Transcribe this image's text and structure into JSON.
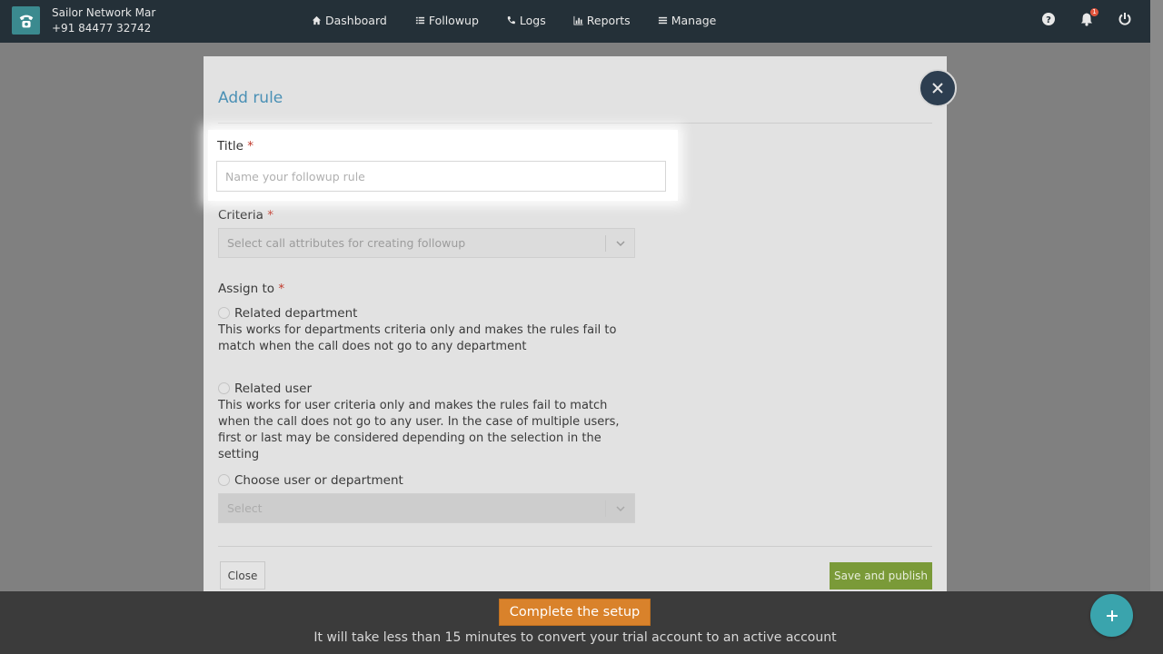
{
  "header": {
    "account_name": "Sailor Network Mar",
    "account_phone": "+91 84477 32742",
    "nav": [
      {
        "label": "Dashboard",
        "icon": "home-icon"
      },
      {
        "label": "Followup",
        "icon": "list-icon"
      },
      {
        "label": "Logs",
        "icon": "phone-icon"
      },
      {
        "label": "Reports",
        "icon": "bar-chart-icon"
      },
      {
        "label": "Manage",
        "icon": "menu-icon"
      }
    ],
    "notification_count": "1"
  },
  "modal": {
    "title": "Add rule",
    "title_field": {
      "label": "Title",
      "required": "*",
      "placeholder": "Name your followup rule",
      "value": ""
    },
    "criteria": {
      "label": "Criteria",
      "required": "*",
      "placeholder": "Select call attributes for creating followup"
    },
    "assign_to": {
      "label": "Assign to",
      "required": "*",
      "options": [
        {
          "label": "Related department",
          "description": "This works for departments criteria only and makes the rules fail to match when the call does not go to any department"
        },
        {
          "label": "Related user",
          "description": "This works for user criteria only and makes the rules fail to match when the call does not go to any user. In the case of multiple users, first or last may be considered depending on the selection in the setting"
        },
        {
          "label": "Choose user or department",
          "description": ""
        }
      ],
      "select_placeholder": "Select"
    },
    "close_label": "Close",
    "save_label": "Save and publish"
  },
  "banner": {
    "button_label": "Complete the setup",
    "text": "It will take less than 15 minutes to convert your trial account to an active account"
  },
  "colors": {
    "navbar": "#243038",
    "accent_blue": "#4a90b5",
    "save_green": "#7a9a38",
    "setup_orange": "#d9822b",
    "fab_teal": "#3aa4ad"
  }
}
